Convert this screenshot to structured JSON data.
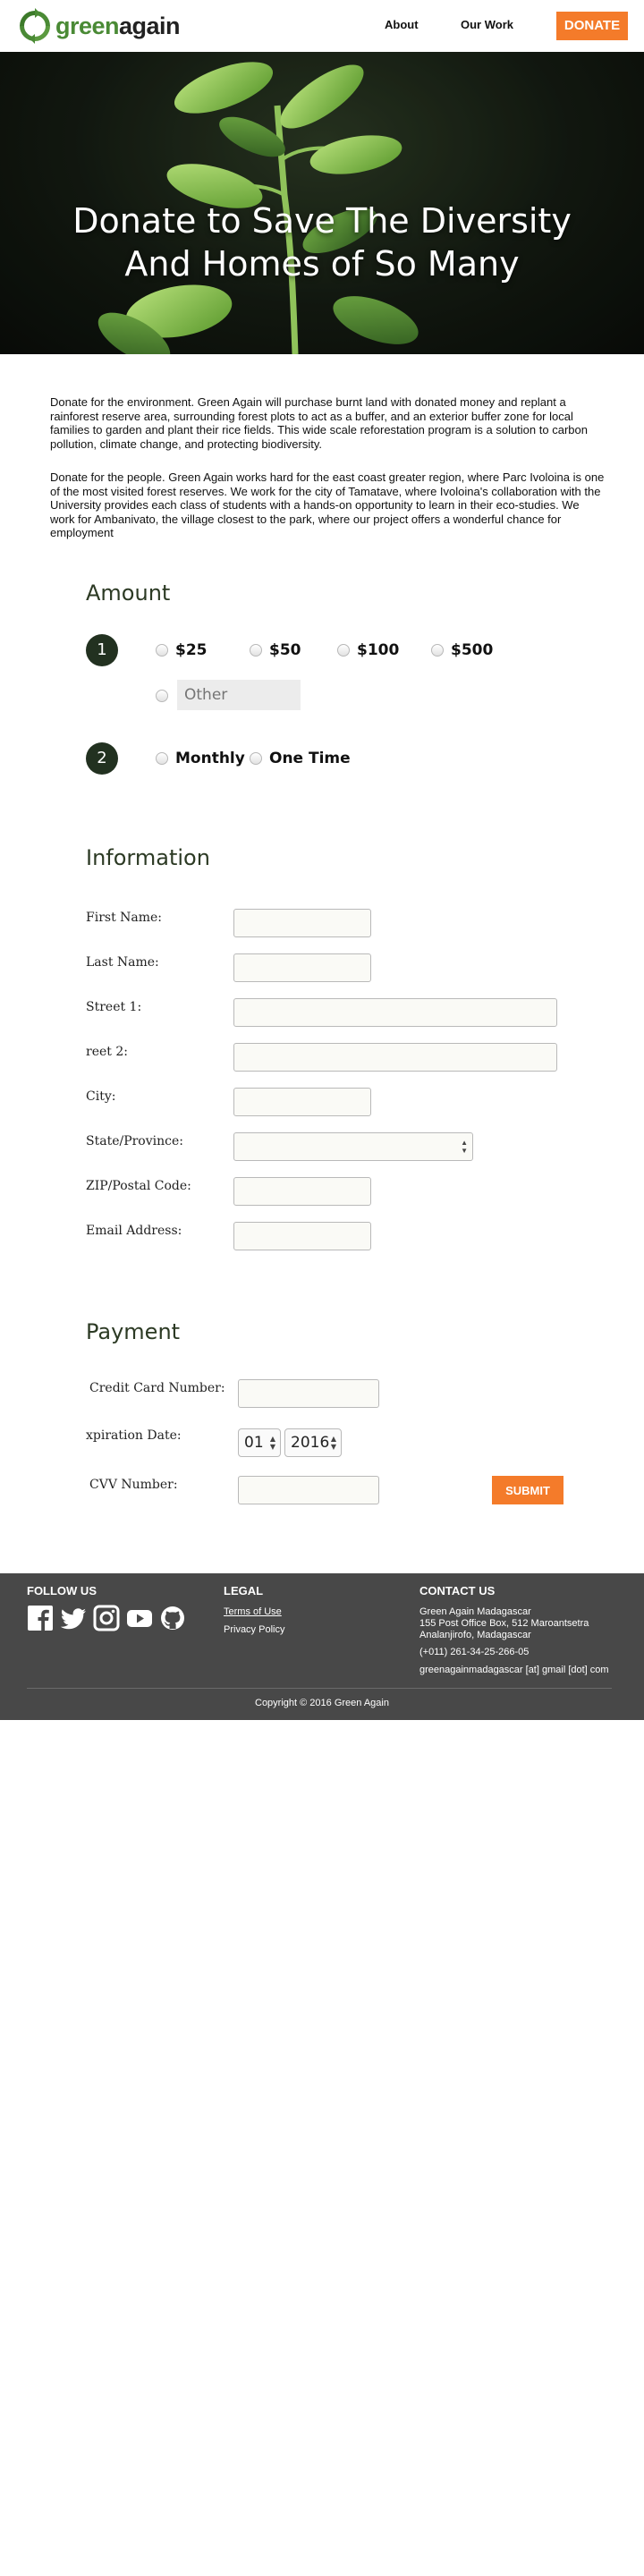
{
  "nav": {
    "logo_green": "green",
    "logo_dark": "again",
    "links": [
      "About",
      "Our Work"
    ],
    "donate": "DONATE"
  },
  "hero": {
    "title": "Donate to Save The Diversity And Homes of So Many"
  },
  "intro": {
    "p1": "Donate for the environment. Green Again will purchase burnt land with donated money and replant a rainforest reserve area, surrounding forest plots to act as a buffer, and an exterior buffer zone for local families to garden and plant their rice fields. This wide scale reforestation program is a solution to carbon pollution, climate change, and protecting biodiversity.",
    "p2": "Donate for the people. Green Again works hard for the east coast greater region, where Parc Ivoloina is one of the most visited forest reserves. We work for the city of Tamatave, where Ivoloina's collaboration with the University provides each class of students with a hands-on opportunity to learn in their eco-studies. We work for Ambanivato, the village closest to the park, where our project offers a wonderful chance for employment"
  },
  "amount": {
    "title": "Amount",
    "step1": "1",
    "step2": "2",
    "options": [
      "$25",
      "$50",
      "$100",
      "$500"
    ],
    "other_placeholder": "Other",
    "frequency": [
      "Monthly",
      "One Time"
    ]
  },
  "information": {
    "title": "Information",
    "fields": {
      "first_name": "First Name:",
      "last_name": "Last Name:",
      "street1": "Street 1:",
      "street2": "reet 2:",
      "city": "City:",
      "state": "State/Province:",
      "zip": "ZIP/Postal Code:",
      "email": "Email Address:"
    }
  },
  "payment": {
    "title": "Payment",
    "card_label": "Credit Card Number:",
    "expiry_label": "xpiration Date:",
    "expiry_month": "01",
    "expiry_year": "2016",
    "cvv_label": "CVV Number:",
    "submit": "SUBMIT"
  },
  "footer": {
    "follow_title": "FOLLOW US",
    "social_icons": [
      "facebook-icon",
      "twitter-icon",
      "instagram-icon",
      "youtube-icon",
      "github-icon"
    ],
    "legal_title": "LEGAL",
    "legal_links": [
      "Terms of Use",
      "Privacy Policy"
    ],
    "contact_title": "CONTACT US",
    "contact_org": "Green Again Madagascar",
    "contact_addr1": "155 Post Office Box, 512 Maroantsetra",
    "contact_addr2": "Analanjirofo, Madagascar",
    "contact_phone": "(+011) 261-34-25-266-05",
    "contact_email": "greenagainmadagascar [at] gmail [dot] com",
    "copyright": "Copyright © 2016 Green Again"
  },
  "colors": {
    "brand_green": "#4a8a35",
    "accent_orange": "#f47b2a",
    "step_circle": "#223120",
    "footer_bg": "#484848"
  }
}
